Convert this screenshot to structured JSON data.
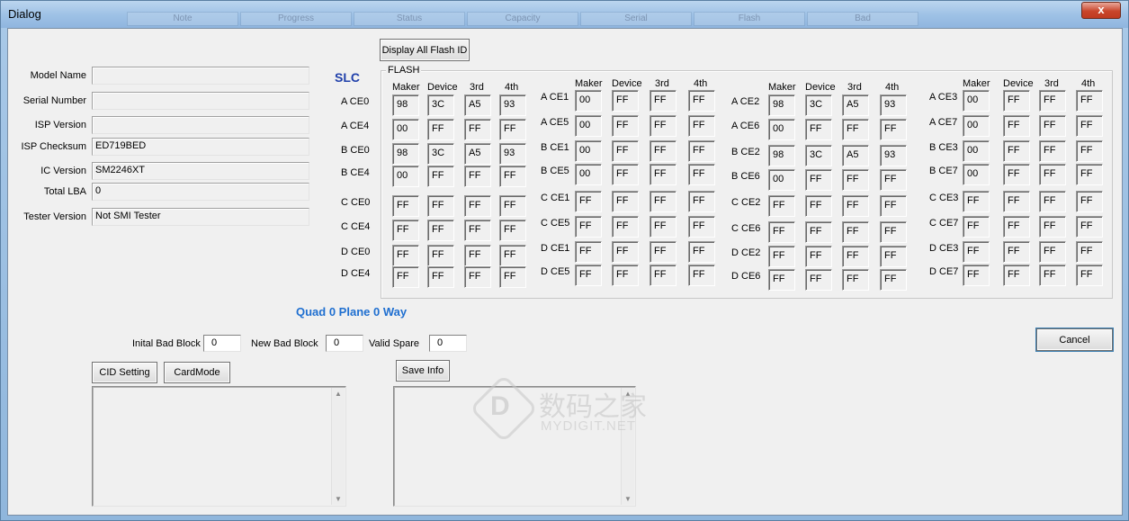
{
  "window": {
    "title": "Dialog",
    "close_glyph": "x",
    "ghost_tabs": [
      "Note",
      "Progress",
      "Status",
      "Capacity",
      "Serial",
      "Flash",
      "Bad"
    ]
  },
  "info": {
    "rows": [
      {
        "label": "Model Name",
        "value": ""
      },
      {
        "label": "Serial Number",
        "value": ""
      },
      {
        "label": "ISP Version",
        "value": ""
      },
      {
        "label": "ISP Checksum",
        "value": "ED719BED"
      },
      {
        "label": "IC Version",
        "value": "SM2246XT"
      },
      {
        "label": "Total LBA",
        "value": "0"
      },
      {
        "label": "Tester Version",
        "value": "Not SMI Tester"
      }
    ]
  },
  "flash": {
    "display_all_label": "Display All Flash ID",
    "slc_label": "SLC",
    "group_label": "FLASH",
    "col_headers": [
      "Maker",
      "Device",
      "3rd",
      "4th"
    ],
    "columns": [
      {
        "rows": [
          {
            "name": "A CE0",
            "values": [
              "98",
              "3C",
              "A5",
              "93"
            ]
          },
          {
            "name": "A CE4",
            "values": [
              "00",
              "FF",
              "FF",
              "FF"
            ]
          },
          {
            "name": "B CE0",
            "values": [
              "98",
              "3C",
              "A5",
              "93"
            ]
          },
          {
            "name": "B CE4",
            "values": [
              "00",
              "FF",
              "FF",
              "FF"
            ]
          },
          {
            "name": "C CE0",
            "values": [
              "FF",
              "FF",
              "FF",
              "FF"
            ]
          },
          {
            "name": "C CE4",
            "values": [
              "FF",
              "FF",
              "FF",
              "FF"
            ]
          },
          {
            "name": "D CE0",
            "values": [
              "FF",
              "FF",
              "FF",
              "FF"
            ]
          },
          {
            "name": "D CE4",
            "values": [
              "FF",
              "FF",
              "FF",
              "FF"
            ]
          }
        ]
      },
      {
        "rows": [
          {
            "name": "A CE1",
            "values": [
              "00",
              "FF",
              "FF",
              "FF"
            ]
          },
          {
            "name": "A CE5",
            "values": [
              "00",
              "FF",
              "FF",
              "FF"
            ]
          },
          {
            "name": "B CE1",
            "values": [
              "00",
              "FF",
              "FF",
              "FF"
            ]
          },
          {
            "name": "B CE5",
            "values": [
              "00",
              "FF",
              "FF",
              "FF"
            ]
          },
          {
            "name": "C CE1",
            "values": [
              "FF",
              "FF",
              "FF",
              "FF"
            ]
          },
          {
            "name": "C CE5",
            "values": [
              "FF",
              "FF",
              "FF",
              "FF"
            ]
          },
          {
            "name": "D CE1",
            "values": [
              "FF",
              "FF",
              "FF",
              "FF"
            ]
          },
          {
            "name": "D CE5",
            "values": [
              "FF",
              "FF",
              "FF",
              "FF"
            ]
          }
        ]
      },
      {
        "rows": [
          {
            "name": "A CE2",
            "values": [
              "98",
              "3C",
              "A5",
              "93"
            ]
          },
          {
            "name": "A CE6",
            "values": [
              "00",
              "FF",
              "FF",
              "FF"
            ]
          },
          {
            "name": "B CE2",
            "values": [
              "98",
              "3C",
              "A5",
              "93"
            ]
          },
          {
            "name": "B CE6",
            "values": [
              "00",
              "FF",
              "FF",
              "FF"
            ]
          },
          {
            "name": "C CE2",
            "values": [
              "FF",
              "FF",
              "FF",
              "FF"
            ]
          },
          {
            "name": "C CE6",
            "values": [
              "FF",
              "FF",
              "FF",
              "FF"
            ]
          },
          {
            "name": "D CE2",
            "values": [
              "FF",
              "FF",
              "FF",
              "FF"
            ]
          },
          {
            "name": "D CE6",
            "values": [
              "FF",
              "FF",
              "FF",
              "FF"
            ]
          }
        ]
      },
      {
        "rows": [
          {
            "name": "A CE3",
            "values": [
              "00",
              "FF",
              "FF",
              "FF"
            ]
          },
          {
            "name": "A CE7",
            "values": [
              "00",
              "FF",
              "FF",
              "FF"
            ]
          },
          {
            "name": "B CE3",
            "values": [
              "00",
              "FF",
              "FF",
              "FF"
            ]
          },
          {
            "name": "B CE7",
            "values": [
              "00",
              "FF",
              "FF",
              "FF"
            ]
          },
          {
            "name": "C CE3",
            "values": [
              "FF",
              "FF",
              "FF",
              "FF"
            ]
          },
          {
            "name": "C CE7",
            "values": [
              "FF",
              "FF",
              "FF",
              "FF"
            ]
          },
          {
            "name": "D CE3",
            "values": [
              "FF",
              "FF",
              "FF",
              "FF"
            ]
          },
          {
            "name": "D CE7",
            "values": [
              "FF",
              "FF",
              "FF",
              "FF"
            ]
          }
        ]
      }
    ]
  },
  "mode_text": "Quad 0 Plane  0 Way",
  "blocks": {
    "initial_label": "Inital Bad Block",
    "initial_value": "0",
    "new_label": "New Bad Block",
    "new_value": "0",
    "spare_label": "Valid Spare",
    "spare_value": "0"
  },
  "buttons": {
    "cid_setting": "CID Setting",
    "card_mode": "CardMode",
    "save_info": "Save Info",
    "cancel": "Cancel"
  },
  "watermark": {
    "logo_letter": "D",
    "cn": "数码之家",
    "en": "MYDIGIT.NET"
  },
  "colors": {
    "slc": "#1f3faa",
    "mode": "#1f6fd0",
    "titlebar": "#9fc2e6",
    "close": "#c9462c"
  }
}
